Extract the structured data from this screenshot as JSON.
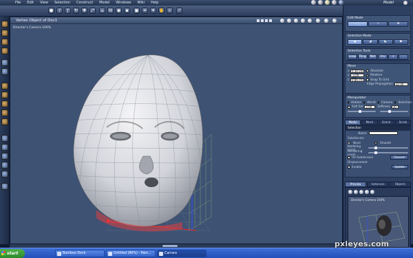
{
  "menubar": {
    "items": [
      "File",
      "Edit",
      "View",
      "Selection",
      "Construct",
      "Model",
      "Windows",
      "Wiki",
      "Help"
    ],
    "app_title": "Model"
  },
  "viewport": {
    "title": "Vertex Object of Doc1",
    "camera_label": "Director's Camera 100%"
  },
  "panel": {
    "edit_mode_title": "Edit Mode",
    "selection_mode_title": "Selection Mode",
    "selection_tools_title": "Selection Tools",
    "selection_tools": [
      "Loop",
      "Ring",
      "Net",
      "Inv",
      "+",
      "-"
    ],
    "move_title": "Move",
    "move_values": [
      "0.36 cm",
      "-3.00 cm",
      "0.86 cm"
    ],
    "move_options": [
      "Absolute",
      "Relative",
      "Snap To Grid"
    ],
    "edge_propagation_label": "Edge Propagation",
    "edge_propagation_value": "32.00",
    "manipulator_title": "Manipulator",
    "manipulator_options": [
      "Hidden",
      "World",
      "Camera",
      "Selection"
    ],
    "soft_sel_label": "Soft Sel",
    "soft_sel_value": "2.00",
    "softness_label": "Softness",
    "softness_value": "30"
  },
  "tabs": [
    "Model",
    "Mesh",
    "Scene",
    "Scrub"
  ],
  "props": {
    "header": "Selection",
    "name_label": "Name",
    "subdivision_label": "Subdivision",
    "subdivision_options": [
      "None",
      "Smooth"
    ],
    "modeling_level_label": "Modeling Level",
    "rendering_level_label": "Rendering Level",
    "uv_subdivision_label": "UV Subdivision",
    "convert_label": "Convert",
    "displacement_label": "Displacement",
    "enable_label": "Enable",
    "update_label": "Update"
  },
  "preview": {
    "tabs": [
      "Preview",
      "Instances",
      "Objects"
    ],
    "camera_label": "Director's Camera 100%"
  },
  "taskbar": {
    "start": "start",
    "tasks": [
      "Bamboo Dock",
      "Untitled (80%) - Pain...",
      "Carrara"
    ]
  },
  "watermark": "pxleyes.com",
  "colors": {
    "viewport_bg": "#3e5273",
    "panel_bg": "#2d4062",
    "accent": "#6c8fce",
    "taskbar": "#2350b8"
  }
}
